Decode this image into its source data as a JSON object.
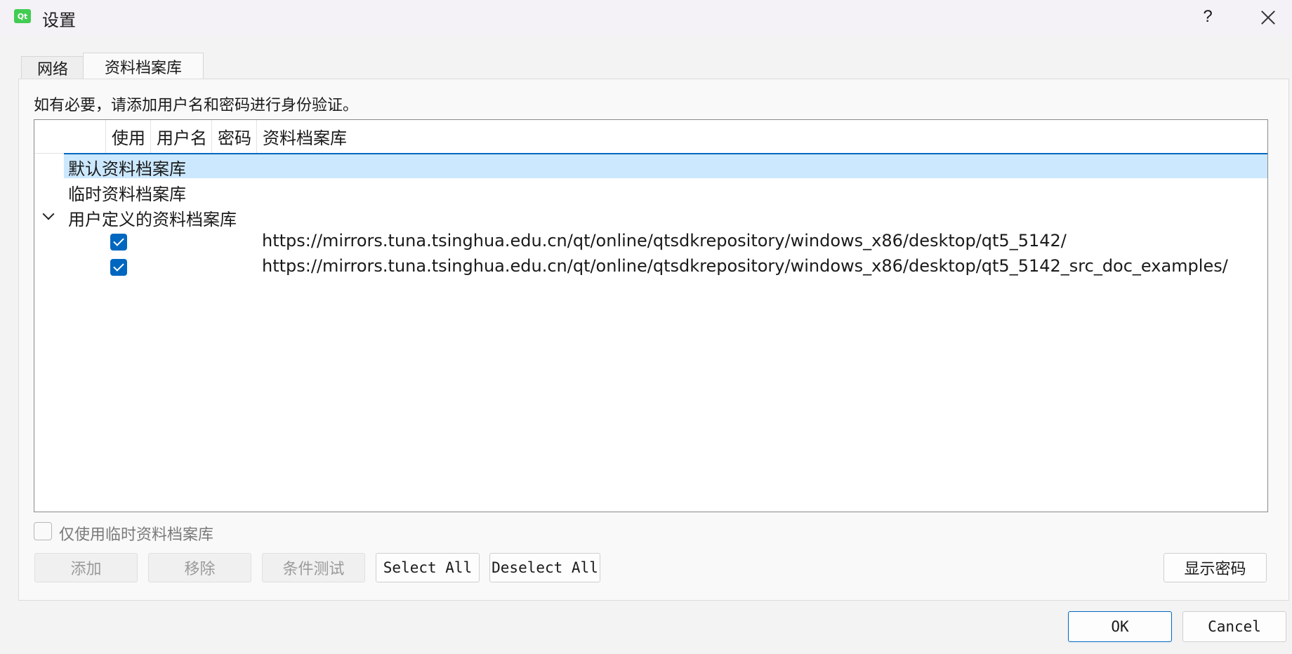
{
  "window": {
    "title": "设置",
    "app_icon_text": "Qt",
    "help_label": "?"
  },
  "tabs": [
    {
      "label": "网络"
    },
    {
      "label": "资料档案库"
    }
  ],
  "hint": "如有必要，请添加用户名和密码进行身份验证。",
  "tree": {
    "columns": [
      "使用",
      "用户名",
      "密码",
      "资料档案库"
    ],
    "rows": [
      {
        "label": "默认资料档案库"
      },
      {
        "label": "临时资料档案库"
      },
      {
        "label": "用户定义的资料档案库"
      }
    ],
    "urls": [
      {
        "checked": true,
        "url": "https://mirrors.tuna.tsinghua.edu.cn/qt/online/qtsdkrepository/windows_x86/desktop/qt5_5142/"
      },
      {
        "checked": true,
        "url": "https://mirrors.tuna.tsinghua.edu.cn/qt/online/qtsdkrepository/windows_x86/desktop/qt5_5142_src_doc_examples/"
      }
    ]
  },
  "temp_only_label": "仅使用临时资料档案库",
  "buttons": {
    "add": "添加",
    "remove": "移除",
    "test": "条件测试",
    "select_all": "Select All",
    "deselect_all": "Deselect All",
    "show_password": "显示密码",
    "ok": "OK",
    "cancel": "Cancel"
  },
  "colors": {
    "accent": "#0067c0",
    "selection": "#cce8ff",
    "qt_green": "#41cd52"
  }
}
